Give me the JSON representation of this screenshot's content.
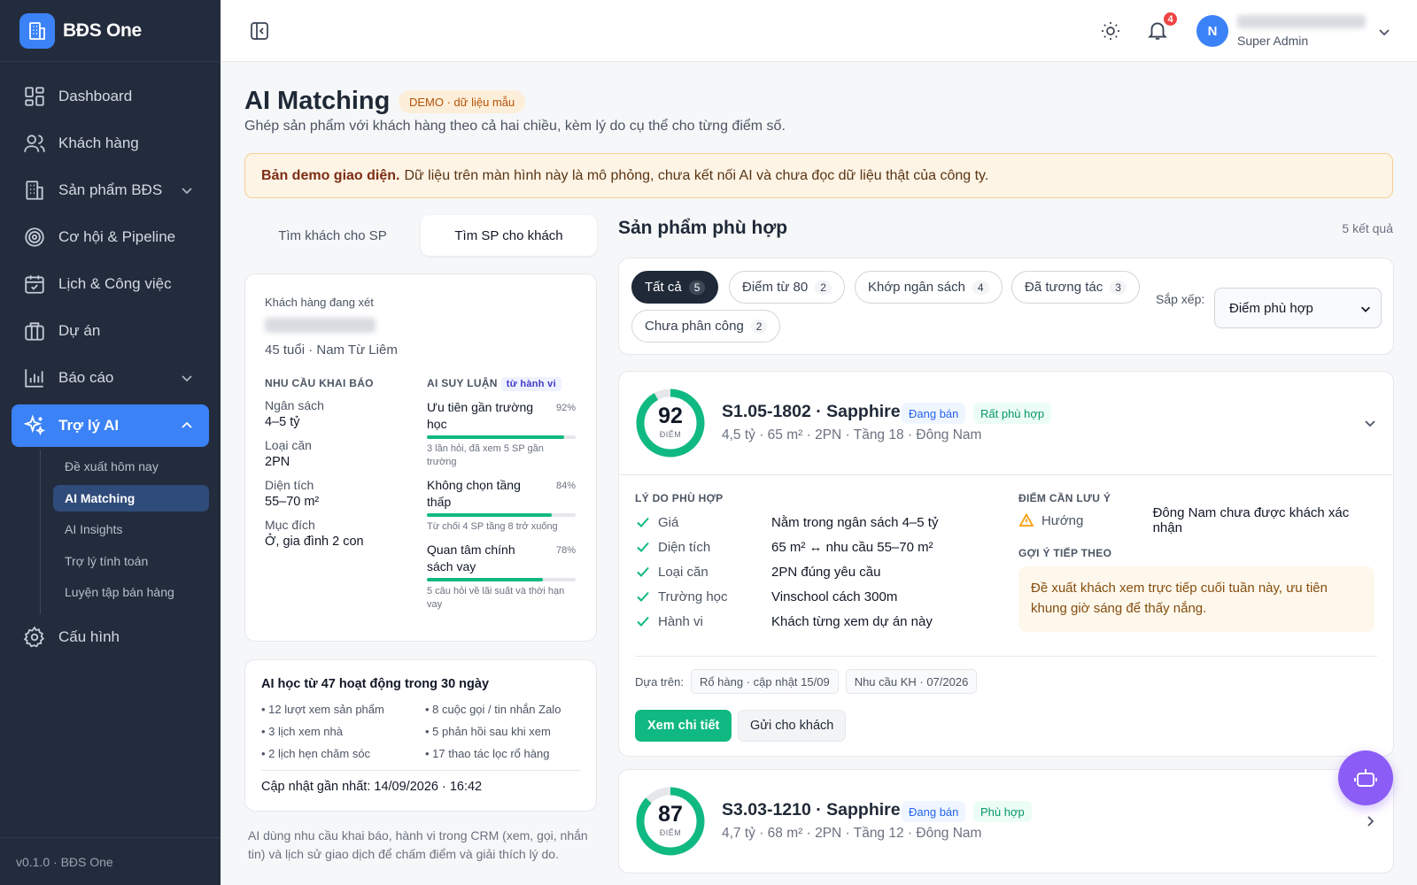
{
  "app": {
    "name": "BĐS One",
    "version": "v0.1.0 · BĐS One"
  },
  "sidebar": {
    "items": [
      {
        "label": "Dashboard",
        "icon": "dashboard-icon"
      },
      {
        "label": "Khách hàng",
        "icon": "users-icon"
      },
      {
        "label": "Sản phẩm BĐS",
        "icon": "building-icon"
      },
      {
        "label": "Cơ hội & Pipeline",
        "icon": "target-icon"
      },
      {
        "label": "Lịch & Công việc",
        "icon": "calendar-icon"
      },
      {
        "label": "Dự án",
        "icon": "briefcase-icon"
      },
      {
        "label": "Báo cáo",
        "icon": "bar-chart-icon"
      },
      {
        "label": "Trợ lý AI",
        "icon": "sparkles-icon"
      },
      {
        "label": "Cấu hình",
        "icon": "gear-icon"
      }
    ],
    "sub_items": [
      "Đề xuất hôm nay",
      "AI Matching",
      "AI Insights",
      "Trợ lý tính toán",
      "Luyện tập bán hàng"
    ]
  },
  "header": {
    "notifications": "4",
    "avatar_initial": "N",
    "role": "Super Admin"
  },
  "page": {
    "title": "AI Matching",
    "badge": "DEMO · dữ liệu mẫu",
    "subtitle": "Ghép sản phẩm với khách hàng theo cả hai chiều, kèm lý do cụ thể cho từng điểm số.",
    "alert_bold": "Bản demo giao diện.",
    "alert_text": "Dữ liệu trên màn hình này là mô phỏng, chưa kết nối AI và chưa đọc dữ liệu thật của công ty."
  },
  "tabs": [
    "Tìm khách cho SP",
    "Tìm SP cho khách"
  ],
  "customer": {
    "heading": "Khách hàng đang xét",
    "meta": "45 tuổi · Nam Từ Liêm",
    "needs_heading": "NHU CẦU KHAI BÁO",
    "needs": [
      {
        "k": "Ngân sách",
        "v": "4–5 tỷ"
      },
      {
        "k": "Loại căn",
        "v": "2PN"
      },
      {
        "k": "Diện tích",
        "v": "55–70 m²"
      },
      {
        "k": "Mục đích",
        "v": "Ở, gia đình 2 con"
      }
    ],
    "ai_heading": "AI SUY LUẬN",
    "ai_tag": "từ hành vi",
    "ai_items": [
      {
        "t": "Ưu tiên gần trường học",
        "pct": "92%",
        "value": 0.92,
        "d": "3 lần hỏi, đã xem 5 SP gần trường"
      },
      {
        "t": "Không chọn tầng thấp",
        "pct": "84%",
        "value": 0.84,
        "d": "Từ chối 4 SP tầng 8 trở xuống"
      },
      {
        "t": "Quan tâm chính sách vay",
        "pct": "78%",
        "value": 0.78,
        "d": "5 câu hỏi về lãi suất và thời hạn vay"
      }
    ]
  },
  "learning": {
    "title": "AI học từ 47 hoạt động trong 30 ngày",
    "items": [
      "• 12 lượt xem sản phẩm",
      "• 8 cuộc gọi / tin nhắn Zalo",
      "• 3 lịch xem nhà",
      "• 5 phản hồi sau khi xem",
      "• 2 lịch hẹn chăm sóc",
      "• 17 thao tác lọc rổ hàng"
    ],
    "updated": "Cập nhật gần nhất: 14/09/2026 · 16:42"
  },
  "footnote": "AI dùng nhu cầu khai báo, hành vi trong CRM (xem, gọi, nhắn tin) và lịch sử giao dịch để chấm điểm và giải thích lý do.",
  "results": {
    "title": "Sản phẩm phù hợp",
    "count": "5 kết quả",
    "chips": [
      {
        "label": "Tất cả",
        "n": "5"
      },
      {
        "label": "Điểm từ 80",
        "n": "2"
      },
      {
        "label": "Khớp ngân sách",
        "n": "4"
      },
      {
        "label": "Đã tương tác",
        "n": "3"
      },
      {
        "label": "Chưa phân công",
        "n": "2"
      }
    ],
    "sort_label": "Sắp xếp:",
    "sort_value": "Điểm phù hợp"
  },
  "products": [
    {
      "score": "92",
      "score_value": 92,
      "unit": "ĐIỂM",
      "title": "S1.05-1802 · Sapphire",
      "status": "Đang bán",
      "fit": "Rất phù hợp",
      "meta": "4,5 tỷ · 65 m² · 2PN · Tầng 18 · Đông Nam",
      "reasons_heading": "LÝ DO PHÙ HỢP",
      "reasons": [
        {
          "k": "Giá",
          "v": "Nằm trong ngân sách 4–5 tỷ"
        },
        {
          "k": "Diện tích",
          "v": "65 m² ↔ nhu cầu 55–70 m²"
        },
        {
          "k": "Loại căn",
          "v": "2PN đúng yêu cầu"
        },
        {
          "k": "Trường học",
          "v": "Vinschool cách 300m"
        },
        {
          "k": "Hành vi",
          "v": "Khách từng xem dự án này"
        }
      ],
      "notes_heading": "ĐIỂM CẦN LƯU Ý",
      "note": {
        "k": "Hướng",
        "v": "Đông Nam chưa được khách xác nhận"
      },
      "next_heading": "GỢI Ý TIẾP THEO",
      "next": "Đề xuất khách xem trực tiếp cuối tuần này, ưu tiên khung giờ sáng để thấy nắng.",
      "based_label": "Dựa trên:",
      "sources": [
        "Rổ hàng · cập nhật 15/09",
        "Nhu cầu KH · 07/2026"
      ],
      "btn_detail": "Xem chi tiết",
      "btn_send": "Gửi cho khách"
    },
    {
      "score": "87",
      "score_value": 87,
      "unit": "ĐIỂM",
      "title": "S3.03-1210 · Sapphire",
      "status": "Đang bán",
      "fit": "Phù hợp",
      "meta": "4,7 tỷ · 68 m² · 2PN · Tầng 12 · Đông Nam"
    }
  ],
  "colors": {
    "sidebar": "#232c3c",
    "accent": "#3b82f6",
    "success": "#10b981",
    "fab": "#8b5cf6"
  }
}
